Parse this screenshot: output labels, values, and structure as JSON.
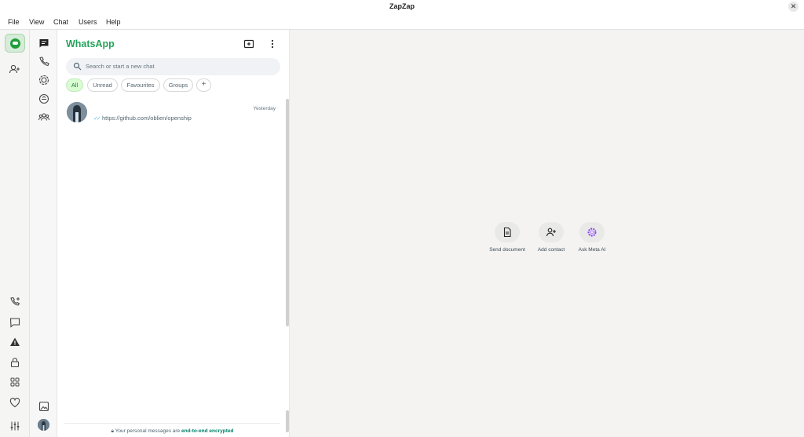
{
  "window": {
    "title": "ZapZap",
    "close_glyph": "✕"
  },
  "menu": [
    "File",
    "View",
    "Chat",
    "Users",
    "Help"
  ],
  "rail": {
    "icons": [
      "zapzap-app-icon",
      "add-user-icon",
      "add-call-icon",
      "message-icon",
      "warning-icon",
      "lock-icon",
      "apps-grid-icon",
      "heart-icon",
      "settings-sliders-icon"
    ]
  },
  "nav": {
    "icons": [
      "chats-icon",
      "calls-icon",
      "status-icon",
      "channels-icon",
      "communities-icon",
      "media-icon",
      "profile-avatar"
    ]
  },
  "chatlist": {
    "brand": "WhatsApp",
    "search_placeholder": "Search or start a new chat",
    "filters": [
      {
        "label": "All",
        "active": true
      },
      {
        "label": "Unread",
        "active": false
      },
      {
        "label": "Favourites",
        "active": false
      },
      {
        "label": "Groups",
        "active": false
      },
      {
        "label": "+",
        "active": false
      }
    ],
    "chats": [
      {
        "time": "Yesterday",
        "preview": "https://github.com/oblien/openship",
        "read": true
      }
    ],
    "encryption": {
      "prefix": "Your personal messages are ",
      "link": "end-to-end encrypted"
    }
  },
  "main": {
    "actions": [
      {
        "label": "Send document",
        "icon": "document-icon"
      },
      {
        "label": "Add contact",
        "icon": "add-contact-icon"
      },
      {
        "label": "Ask Meta AI",
        "icon": "meta-ai-icon"
      }
    ]
  },
  "colors": {
    "brand": "#25a35a",
    "accent_chip": "#d9fdd3",
    "main_bg": "#f4f3f2",
    "ticks": "#53bdeb",
    "meta_ai": "#8a3ffc"
  }
}
